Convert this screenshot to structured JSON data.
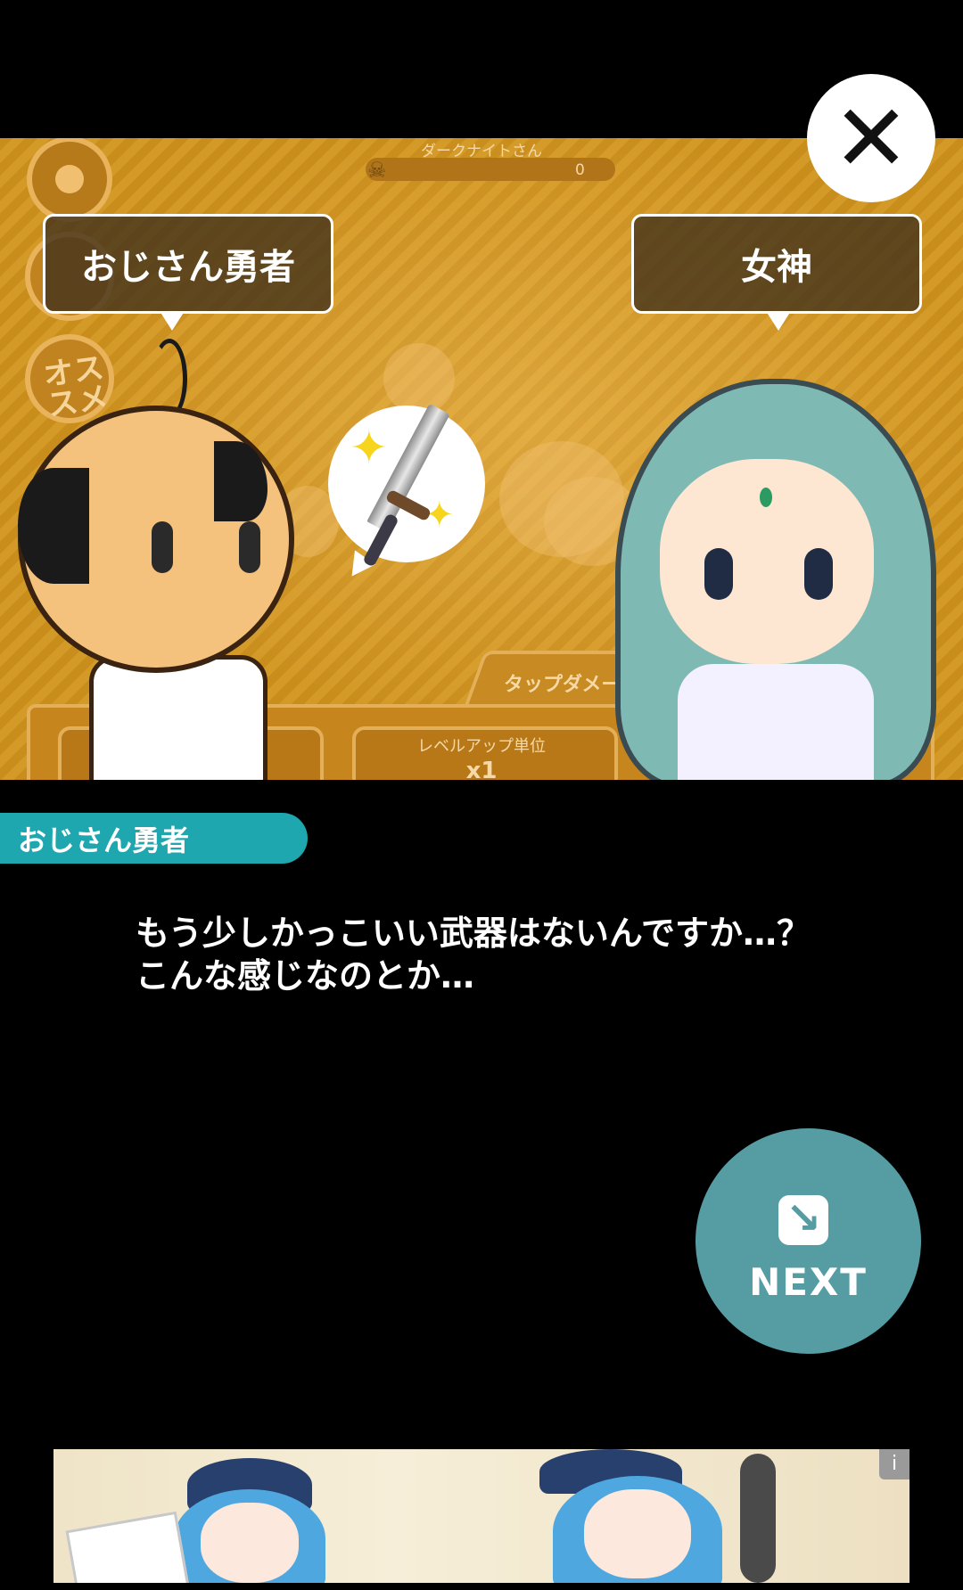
{
  "game_hud": {
    "enemy_name": "ダークナイトさん",
    "kill_count": "0",
    "side_button_label": "オススメ",
    "tap_damage_label": "タップダメージ",
    "level_up_unit_label": "レベルアップ単位",
    "level_up_unit_value": "x1"
  },
  "speech_bubbles": {
    "left": "おじさん勇者",
    "right": "女神"
  },
  "dialogue": {
    "speaker": "おじさん勇者",
    "lines": [
      "もう少しかっこいい武器はないんですか…？",
      "こんな感じなのとか…"
    ]
  },
  "buttons": {
    "close_symbol": "✕",
    "next_label": "NEXT"
  },
  "ad": {
    "info_symbol": "i"
  },
  "colors": {
    "speaker_tab": "#1fa7b0",
    "next_button": "#559ca3",
    "scene_overlay": "#cf9422"
  }
}
